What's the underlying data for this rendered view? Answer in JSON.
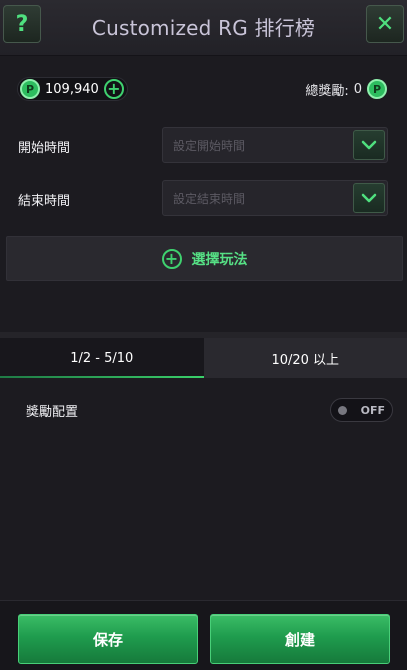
{
  "header": {
    "help_label": "?",
    "title": "Customized RG 排行榜",
    "close_label": "✕"
  },
  "balance": {
    "coin_symbol": "P",
    "value": "109,940",
    "add_label": "+"
  },
  "total_reward": {
    "label": "總獎勵:",
    "value": "0",
    "coin_symbol": "P"
  },
  "start_time": {
    "label": "開始時間",
    "placeholder": "設定開始時間"
  },
  "end_time": {
    "label": "結束時間",
    "placeholder": "設定結束時間"
  },
  "choose_game": {
    "plus": "+",
    "label": "選擇玩法"
  },
  "tabs": [
    {
      "label": "1/2 - 5/10",
      "active": true
    },
    {
      "label": "10/20 以上",
      "active": false
    }
  ],
  "reward_config": {
    "label": "獎勵配置",
    "toggle_state": "OFF"
  },
  "footer": {
    "save_label": "保存",
    "create_label": "創建"
  },
  "colors": {
    "accent": "#3fd16f",
    "background": "#1c1b20"
  }
}
